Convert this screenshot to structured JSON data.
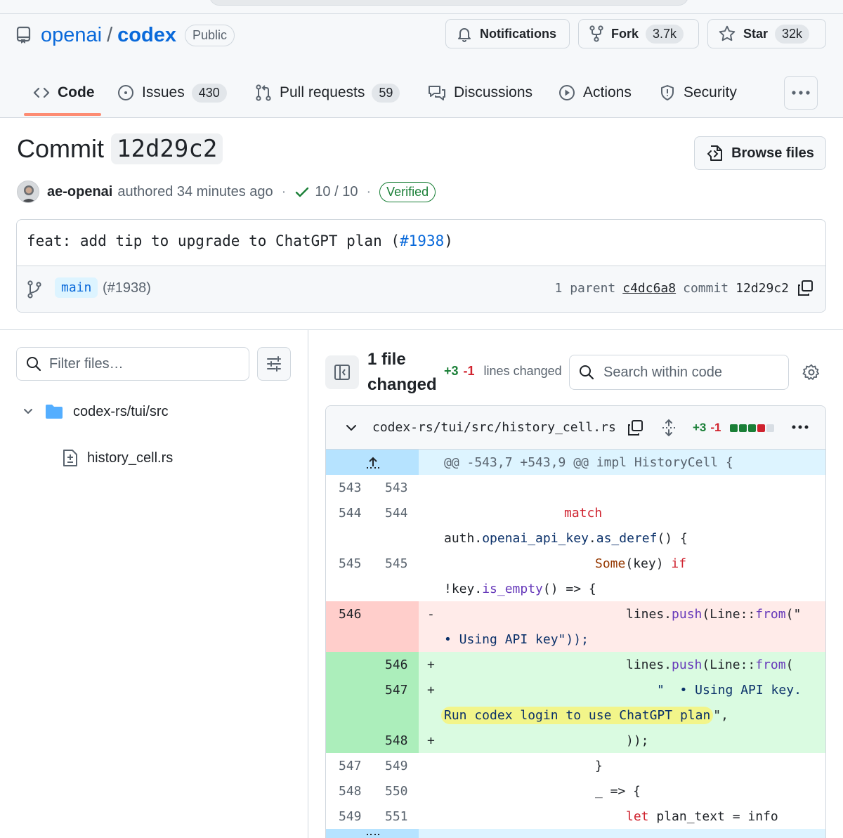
{
  "repo": {
    "owner": "openai",
    "separator": "/",
    "name": "codex",
    "visibility": "Public"
  },
  "header_buttons": {
    "notifications": "Notifications",
    "fork_label": "Fork",
    "fork_count": "3.7k",
    "star_label": "Star",
    "star_count": "32k"
  },
  "tabs": [
    {
      "label": "Code"
    },
    {
      "label": "Issues",
      "count": "430"
    },
    {
      "label": "Pull requests",
      "count": "59"
    },
    {
      "label": "Discussions"
    },
    {
      "label": "Actions"
    },
    {
      "label": "Security"
    }
  ],
  "commit": {
    "title": "Commit",
    "sha": "12d29c2",
    "browse_files": "Browse files",
    "author": "ae-openai",
    "authored": "authored 34 minutes ago",
    "checks": "10 / 10",
    "verified": "Verified",
    "message_prefix": "feat: add tip to upgrade to ChatGPT plan (",
    "message_pr": "#1938",
    "message_suffix": ")",
    "branch": "main",
    "branch_pr": "(#1938)",
    "parent_label": "1 parent",
    "parent_sha": "c4dc6a8",
    "commit_label": "commit",
    "commit_sha": "12d29c2"
  },
  "file_tree": {
    "filter_placeholder": "Filter files…",
    "directory": "codex-rs/tui/src",
    "file": "history_cell.rs"
  },
  "diff_toolbar": {
    "files_line1": "1 file",
    "files_line2": "changed",
    "additions": "+3",
    "deletions": "-1",
    "lines_changed": "lines changed",
    "search_placeholder": "Search within code"
  },
  "diff_file": {
    "path": "codex-rs/tui/src/history_cell.rs",
    "additions": "+3",
    "deletions": "-1",
    "blocks": [
      "#1a7f37",
      "#1a7f37",
      "#1a7f37",
      "#cf222e",
      "#d8dee4"
    ],
    "hunk_header": "@@ -543,7 +543,9 @@ impl HistoryCell {",
    "lines": {
      "l1_old": "543",
      "l1_new": "543",
      "l2_old": "544",
      "l2_new": "544",
      "l2_code_a": "match",
      "l2_code_b1": "auth.",
      "l2_code_b2": "openai_api_key",
      "l2_code_b3": ".",
      "l2_code_b4": "as_deref",
      "l2_code_b5": "() {",
      "l3_old": "545",
      "l3_new": "545",
      "l3_code_a1": "Some",
      "l3_code_a2": "(key) ",
      "l3_code_a3": "if",
      "l3_code_b1": "!key.",
      "l3_code_b2": "is_empty",
      "l3_code_b3": "() => {",
      "del_old": "546",
      "del_sign": "-",
      "del_code_a1": "lines.",
      "del_code_a2": "push",
      "del_code_a3": "(Line::",
      "del_code_a4": "from",
      "del_code_a5": "(\"",
      "del_code_b": "• Using API key\"));",
      "add1_new": "546",
      "add1_sign": "+",
      "add1_code1": "lines.",
      "add1_code2": "push",
      "add1_code3": "(Line::",
      "add1_code4": "from",
      "add1_code5": "(",
      "add2_new": "547",
      "add2_sign": "+",
      "add2_code": "\"  • Using API key.",
      "add2_code_b1": "Run codex login to use ChatGPT plan",
      "add2_code_b2": "\",",
      "add3_new": "548",
      "add3_sign": "+",
      "add3_code": "));",
      "l7_old": "547",
      "l7_new": "549",
      "l7_code": "}",
      "l8_old": "548",
      "l8_new": "550",
      "l8_code": "_ => {",
      "l9_old": "549",
      "l9_new": "551",
      "l9_code_kw": "let",
      "l9_code": " plan_text = info"
    }
  }
}
